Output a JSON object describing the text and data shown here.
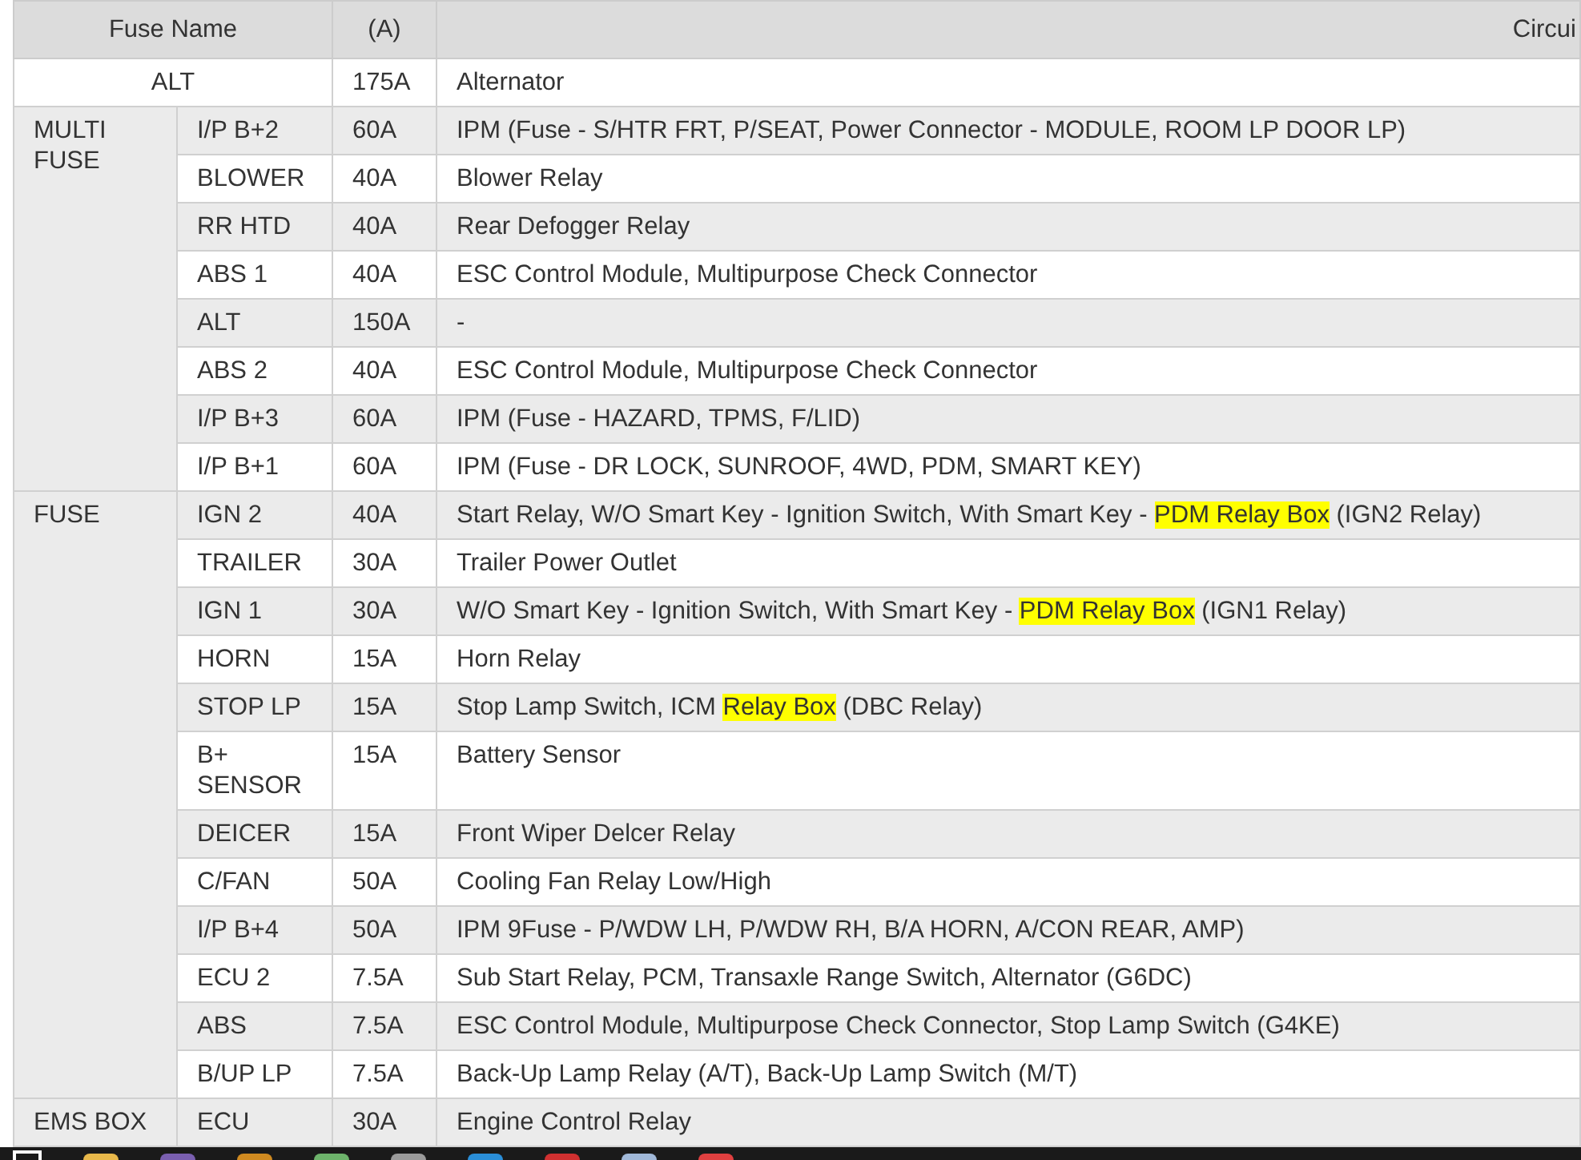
{
  "table": {
    "columns": [
      "Fuse Name",
      "(A)",
      "Circui"
    ],
    "rows": [
      {
        "kind": "single",
        "name": "ALT",
        "rating": "175A",
        "circuit": [
          {
            "text": "Alternator",
            "highlight": false
          }
        ]
      },
      {
        "kind": "group",
        "name": "MULTI FUSE",
        "fuses": [
          {
            "name": "I/P B+2",
            "rating": "60A",
            "circuit": [
              {
                "text": "IPM (Fuse - S/HTR FRT, P/SEAT, Power Connector - MODULE, ROOM LP DOOR LP)",
                "highlight": false
              }
            ]
          },
          {
            "name": "BLOWER",
            "rating": "40A",
            "circuit": [
              {
                "text": "Blower Relay",
                "highlight": false
              }
            ]
          },
          {
            "name": "RR HTD",
            "rating": "40A",
            "circuit": [
              {
                "text": "Rear Defogger Relay",
                "highlight": false
              }
            ]
          },
          {
            "name": "ABS 1",
            "rating": "40A",
            "circuit": [
              {
                "text": "ESC Control Module, Multipurpose Check Connector",
                "highlight": false
              }
            ]
          },
          {
            "name": "ALT",
            "rating": "150A",
            "circuit": [
              {
                "text": "-",
                "highlight": false
              }
            ]
          },
          {
            "name": "ABS 2",
            "rating": "40A",
            "circuit": [
              {
                "text": "ESC Control Module, Multipurpose Check Connector",
                "highlight": false
              }
            ]
          },
          {
            "name": "I/P B+3",
            "rating": "60A",
            "circuit": [
              {
                "text": "IPM (Fuse - HAZARD, TPMS, F/LID)",
                "highlight": false
              }
            ]
          },
          {
            "name": "I/P B+1",
            "rating": "60A",
            "circuit": [
              {
                "text": "IPM (Fuse - DR LOCK, SUNROOF, 4WD, PDM, SMART KEY)",
                "highlight": false
              }
            ]
          }
        ]
      },
      {
        "kind": "group",
        "name": "FUSE",
        "fuses": [
          {
            "name": "IGN 2",
            "rating": "40A",
            "circuit": [
              {
                "text": "Start Relay, W/O Smart Key - Ignition Switch, With Smart Key - ",
                "highlight": false
              },
              {
                "text": "PDM Relay Box",
                "highlight": true
              },
              {
                "text": " (IGN2 Relay)",
                "highlight": false
              }
            ]
          },
          {
            "name": "TRAILER",
            "rating": "30A",
            "circuit": [
              {
                "text": "Trailer Power Outlet",
                "highlight": false
              }
            ]
          },
          {
            "name": "IGN 1",
            "rating": "30A",
            "circuit": [
              {
                "text": "W/O Smart Key - Ignition Switch, With Smart Key - ",
                "highlight": false
              },
              {
                "text": "PDM Relay Box",
                "highlight": true
              },
              {
                "text": " (IGN1 Relay)",
                "highlight": false
              }
            ]
          },
          {
            "name": "HORN",
            "rating": "15A",
            "circuit": [
              {
                "text": "Horn Relay",
                "highlight": false
              }
            ]
          },
          {
            "name": "STOP LP",
            "rating": "15A",
            "circuit": [
              {
                "text": "Stop Lamp Switch, ICM ",
                "highlight": false
              },
              {
                "text": "Relay Box",
                "highlight": true
              },
              {
                "text": " (DBC Relay)",
                "highlight": false
              }
            ]
          },
          {
            "name": "B+ SENSOR",
            "rating": "15A",
            "circuit": [
              {
                "text": "Battery Sensor",
                "highlight": false
              }
            ]
          },
          {
            "name": "DEICER",
            "rating": "15A",
            "circuit": [
              {
                "text": "Front Wiper Delcer Relay",
                "highlight": false
              }
            ]
          },
          {
            "name": "C/FAN",
            "rating": "50A",
            "circuit": [
              {
                "text": "Cooling Fan Relay Low/High",
                "highlight": false
              }
            ]
          },
          {
            "name": "I/P B+4",
            "rating": "50A",
            "circuit": [
              {
                "text": "IPM 9Fuse - P/WDW LH, P/WDW RH, B/A HORN, A/CON REAR, AMP)",
                "highlight": false
              }
            ]
          },
          {
            "name": "ECU 2",
            "rating": "7.5A",
            "circuit": [
              {
                "text": "Sub Start Relay, PCM, Transaxle Range Switch, Alternator (G6DC)",
                "highlight": false
              }
            ]
          },
          {
            "name": "ABS",
            "rating": "7.5A",
            "circuit": [
              {
                "text": "ESC Control Module, Multipurpose Check Connector, Stop Lamp Switch (G4KE)",
                "highlight": false
              }
            ]
          },
          {
            "name": "B/UP LP",
            "rating": "7.5A",
            "circuit": [
              {
                "text": "Back-Up Lamp Relay (A/T), Back-Up Lamp Switch (M/T)",
                "highlight": false
              }
            ]
          }
        ]
      },
      {
        "kind": "group",
        "name": "EMS BOX",
        "fuses": [
          {
            "name": "ECU",
            "rating": "30A",
            "circuit": [
              {
                "text": "Engine Control Relay",
                "highlight": false
              }
            ]
          }
        ]
      }
    ]
  }
}
